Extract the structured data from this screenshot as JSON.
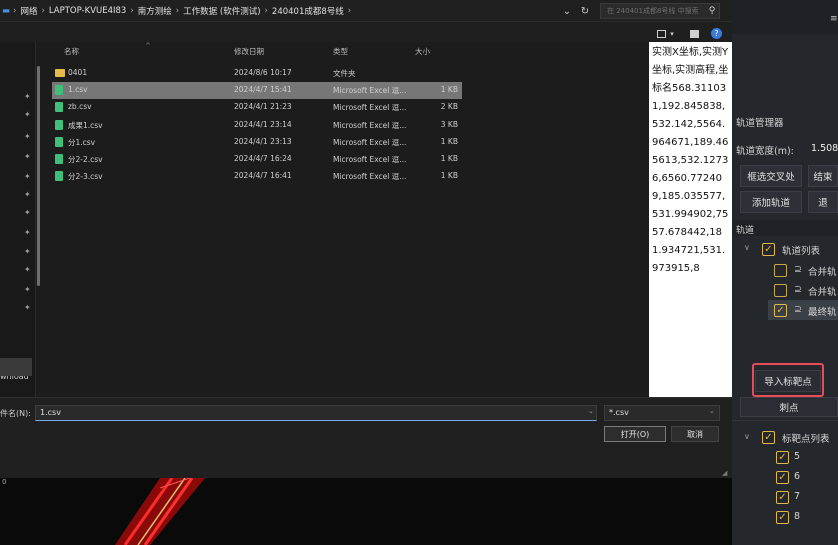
{
  "breadcrumb": {
    "items": [
      "网络",
      "LAPTOP-KVUE4I83",
      "南方测绘",
      "工作数据 (软件测试)",
      "240401成都8号线"
    ],
    "sep": "›"
  },
  "search": {
    "placeholder": "在 240401成都8号线 中搜索"
  },
  "columns": {
    "name": "名称",
    "date": "修改日期",
    "type": "类型",
    "size": "大小"
  },
  "files": [
    {
      "name": "0401",
      "date": "2024/8/6 10:17",
      "type": "文件夹",
      "size": "",
      "kind": "folder"
    },
    {
      "name": "1.csv",
      "date": "2024/4/7 15:41",
      "type": "Microsoft Excel 逗...",
      "size": "1 KB",
      "kind": "csv",
      "selected": true
    },
    {
      "name": "zb.csv",
      "date": "2024/4/1 21:23",
      "type": "Microsoft Excel 逗...",
      "size": "2 KB",
      "kind": "csv"
    },
    {
      "name": "成果1.csv",
      "date": "2024/4/1 23:14",
      "type": "Microsoft Excel 逗...",
      "size": "3 KB",
      "kind": "csv"
    },
    {
      "name": "分1.csv",
      "date": "2024/4/1 23:13",
      "type": "Microsoft Excel 逗...",
      "size": "1 KB",
      "kind": "csv"
    },
    {
      "name": "分2-2.csv",
      "date": "2024/4/7 16:24",
      "type": "Microsoft Excel 逗...",
      "size": "1 KB",
      "kind": "csv"
    },
    {
      "name": "分2-3.csv",
      "date": "2024/4/7 16:41",
      "type": "Microsoft Excel 逗...",
      "size": "1 KB",
      "kind": "csv"
    }
  ],
  "preview_text": "实测X坐标,实测Y坐标,实测高程,坐标名568.311031,192.845838,532.142,5564.964671,189.465613,532.12736,6560.772409,185.035577,531.994902,7557.678442,181.934721,531.973915,8",
  "left_nav": {
    "download_label": "wnload"
  },
  "footer": {
    "filename_label": "件名(N):",
    "filename_value": "1.csv",
    "filetype_value": "*.csv",
    "open_label": "打开(O)",
    "cancel_label": "取消"
  },
  "right_panel": {
    "title": "轨道管理器",
    "width_label": "轨道宽度(m):",
    "width_value": "1.508",
    "btn_select_cross": "框选交叉处",
    "btn_end": "结束",
    "btn_add_track": "添加轨道",
    "btn_back": "退",
    "tracks_header": "轨道",
    "track_list_label": "轨道列表",
    "tracks": [
      {
        "label": "合并轨",
        "checked": false
      },
      {
        "label": "合并轨",
        "checked": false
      },
      {
        "label": "最终轨",
        "checked": true
      }
    ],
    "import_label": "导入标靶点",
    "stab_label": "刺点",
    "target_list_label": "标靶点列表",
    "targets": [
      "5",
      "6",
      "7",
      "8"
    ]
  },
  "colors": {
    "accent": "#e1b84b",
    "highlight": "#e84c5b",
    "selected_row": "#777777"
  }
}
